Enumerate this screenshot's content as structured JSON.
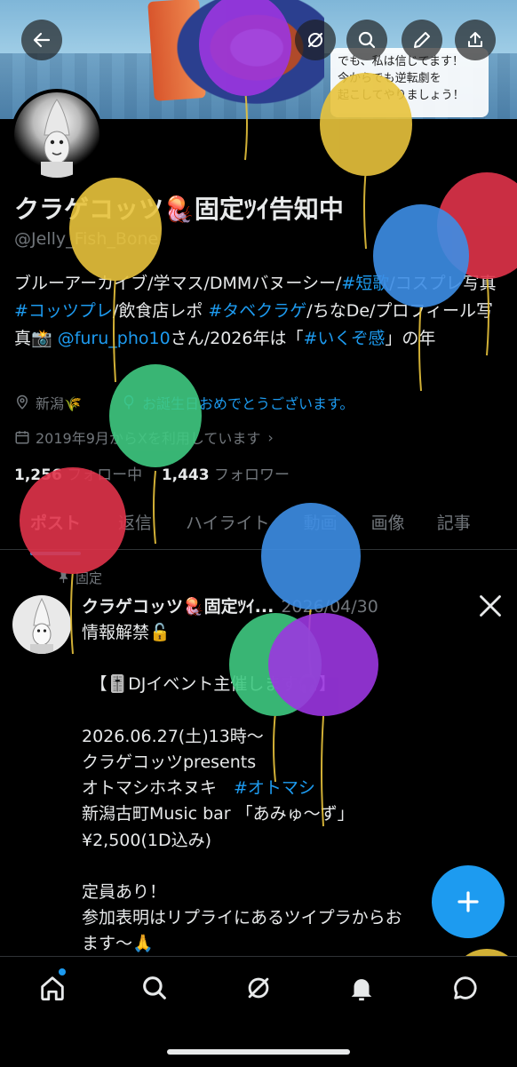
{
  "profile": {
    "display_name": "クラゲコッツ🪼固定ﾂｲ告知中",
    "handle": "@Jelly_Fish_Bone",
    "bio_parts": [
      {
        "text": "ブルーアーカイブ/学マス/DMMバヌーシー/",
        "tag": false
      },
      {
        "text": "#短歌",
        "tag": true
      },
      {
        "text": "/コスプレ写真 ",
        "tag": false
      },
      {
        "text": "#コッツプレ",
        "tag": true
      },
      {
        "text": "/飲食店レポ ",
        "tag": false
      },
      {
        "text": "#タベクラゲ",
        "tag": true
      },
      {
        "text": "/ちなDe/プロフィール写真📸 ",
        "tag": false
      },
      {
        "text": "@furu_pho10",
        "tag": true
      },
      {
        "text": "さん/2026年は「",
        "tag": false
      },
      {
        "text": "#いくぞ感",
        "tag": true
      },
      {
        "text": "」の年",
        "tag": false
      }
    ],
    "location": "新潟🌾",
    "birthday_message": "お誕生日おめでとうございます。",
    "joined": "2019年9月からXを利用しています",
    "following_count": "1,256",
    "following_label": "フォロー中",
    "followers_count": "1,443",
    "followers_label": "フォロワー"
  },
  "banner": {
    "speech_lines": [
      "でも、私は信じてます！",
      "今からでも逆転劇を",
      "起こしてやりましょう！"
    ]
  },
  "tabs": [
    "ポスト",
    "返信",
    "ハイライト",
    "動画",
    "画像",
    "記事"
  ],
  "active_tab": "ポスト",
  "pinned_post": {
    "pinned_label": "固定",
    "author": "クラゲコッツ🪼固定ﾂｲ...",
    "date": "2026/04/30",
    "body_parts": [
      {
        "text": "情報解禁🔓\n\n　【🎚️DJイベント主催します🎧】\n\n2026.06.27(土)13時〜\nクラゲコッツpresents\nオトマシホネヌキ　",
        "tag": false
      },
      {
        "text": "#オトマシ",
        "tag": true
      },
      {
        "text": "\n新潟古町Music bar 「あみゅ〜ず」\n¥2,500(1D込み)\n\n定員あり！\n参加表明はリプライにあるツイプラからお\nます〜🙏",
        "tag": false
      }
    ]
  },
  "icons": {
    "back": "back-arrow-icon",
    "grok": "grok-icon",
    "search": "search-icon",
    "edit": "pencil-icon",
    "share": "share-icon",
    "location": "location-pin-icon",
    "birthday": "balloon-icon",
    "calendar": "calendar-icon",
    "pin": "pin-icon",
    "x_logo": "x-logo-icon",
    "compose": "plus-icon",
    "nav": [
      "home-icon",
      "search-icon",
      "grok-icon",
      "notifications-icon",
      "messages-icon"
    ]
  },
  "colors": {
    "accent": "#1d9bf0",
    "text": "#e7e9ea",
    "muted": "#71767b",
    "background": "#000000",
    "balloon_yellow": "#e8c33c",
    "balloon_purple": "#9b36e0",
    "balloon_blue": "#3d8ee6",
    "balloon_red": "#e0334a",
    "balloon_green": "#3fc981"
  }
}
